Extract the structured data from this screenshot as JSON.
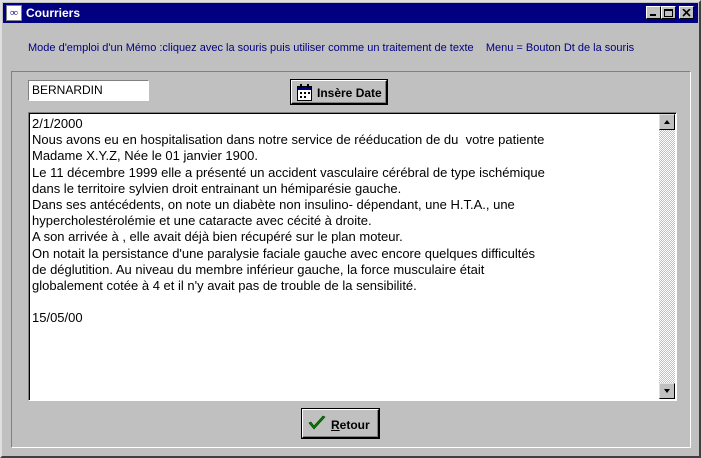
{
  "window": {
    "title": "Courriers",
    "app_icon": "stethoscope-app-icon",
    "controls": [
      "minimize-icon",
      "maximize-icon",
      "close-icon"
    ]
  },
  "hint": {
    "text": "Mode d'emploi d'un Mémo :cliquez avec la souris puis utiliser comme un traitement de texte    Menu = Bouton Dt de la souris"
  },
  "form": {
    "name_value": "BERNARDIN",
    "insert_date_label": "Insère Date",
    "insert_date_icon": "calendar-icon"
  },
  "memo": {
    "text": "2/1/2000\nNous avons eu en hospitalisation dans notre service de rééducation de du  votre patiente\nMadame X.Y.Z, Née le 01 janvier 1900.\nLe 11 décembre 1999 elle a présenté un accident vasculaire cérébral de type ischémique\ndans le territoire sylvien droit entrainant un hémiparésie gauche.\nDans ses antécédents, on note un diabète non insulino- dépendant, une H.T.A., une\nhypercholestérolémie et une cataracte avec cécité à droite.\nA son arrivée à , elle avait déjà bien récupéré sur le plan moteur.\nOn notait la persistance d'une paralysie faciale gauche avec encore quelques difficultés\nde déglutition. Au niveau du membre inférieur gauche, la force musculaire était\nglobalement cotée à 4 et il n'y avait pas de trouble de la sensibilité.\n\n15/05/00"
  },
  "footer": {
    "back_label": "Retour",
    "back_icon": "green-check-icon"
  },
  "colors": {
    "titlebar": "#000080",
    "hint_text": "#000080",
    "face": "#c0c0c0",
    "check": "#008000"
  }
}
